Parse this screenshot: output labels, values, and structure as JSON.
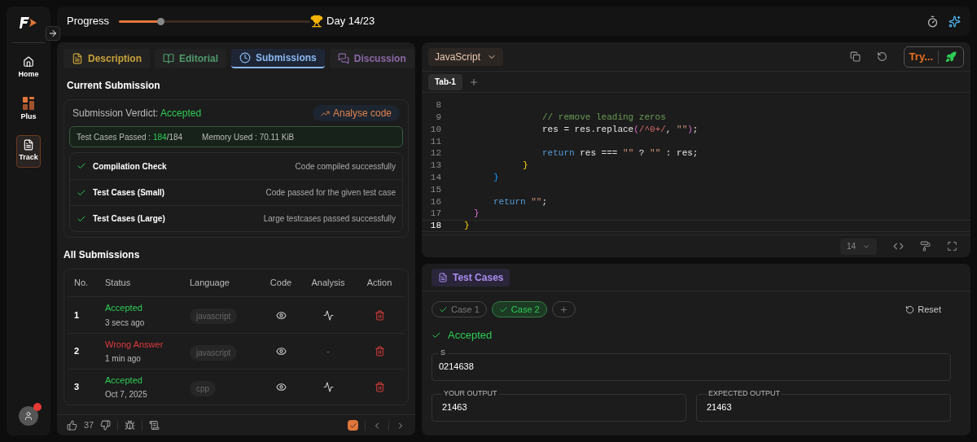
{
  "sidebar": {
    "items": [
      {
        "label": "Home",
        "kind": "home",
        "selected": false
      },
      {
        "label": "Plus",
        "kind": "plus",
        "selected": false
      },
      {
        "label": "Track",
        "kind": "track",
        "selected": true
      }
    ],
    "notification": true
  },
  "progress": {
    "label": "Progress",
    "level": 0.22,
    "day": "Day 14/23"
  },
  "left_tabs": [
    {
      "label": "Description",
      "kind": "description",
      "color": "#c9a23a",
      "selected": false
    },
    {
      "label": "Editorial",
      "kind": "editorial",
      "color": "#4f9a6c",
      "selected": false
    },
    {
      "label": "Submissions",
      "kind": "submissions",
      "color": "#8ab8ef",
      "selected": true
    },
    {
      "label": "Discussion",
      "kind": "discussion",
      "color": "#8a6aa8",
      "selected": false
    }
  ],
  "current_submission": {
    "title": "Current Submission",
    "verdict_label": "Submission Verdict:",
    "verdict": "Accepted",
    "analyse_button": "Analyse code",
    "passed_label": "Test Cases Passed :",
    "passed": "184",
    "total": "/184",
    "memory": "Memory Used : 70.11 KiB",
    "checks": [
      {
        "label": "Compilation Check",
        "detail": "Code compiled successfully"
      },
      {
        "label": "Test Cases (Small)",
        "detail": "Code passed for the given test case"
      },
      {
        "label": "Test Cases (Large)",
        "detail": "Large testcases passed successfully"
      }
    ]
  },
  "all_submissions": {
    "title": "All Submissions",
    "columns": [
      "No.",
      "Status",
      "Language",
      "Code",
      "Analysis",
      "Action"
    ],
    "rows": [
      {
        "no": "1",
        "status": "Accepted",
        "kind": "accepted",
        "time": "3 secs ago",
        "language": "javascript"
      },
      {
        "no": "2",
        "status": "Wrong Answer",
        "kind": "wrong",
        "time": "1 min ago",
        "language": "javascript",
        "analysis": "-"
      },
      {
        "no": "3",
        "status": "Accepted",
        "kind": "accepted",
        "time": "Oct 7, 2025",
        "language": "cpp"
      }
    ]
  },
  "footer": {
    "likes": "37",
    "checked": true
  },
  "editor": {
    "language": "JavaScript",
    "try_button": "Try...",
    "tabs": [
      {
        "label": "Tab-1",
        "selected": true
      }
    ],
    "font_size": "14",
    "lines": [
      {
        "number": "8",
        "selected": false
      },
      {
        "number": "9",
        "selected": false,
        "kind": "depth3",
        "tokens": [
          {
            "kind": "comment",
            "text": "// remove leading zeros"
          }
        ]
      },
      {
        "number": "10",
        "selected": false,
        "kind": "depth3",
        "tokens": [
          {
            "kind": "plain",
            "text": "res = res.replace"
          },
          {
            "kind": "paren",
            "text": "("
          },
          {
            "kind": "regex",
            "text": "/^0+/"
          },
          {
            "kind": "plain",
            "text": ", "
          },
          {
            "kind": "string",
            "text": "\"\""
          },
          {
            "kind": "paren",
            "text": ")"
          },
          {
            "kind": "plain",
            "text": ";"
          }
        ]
      },
      {
        "number": "11",
        "selected": false
      },
      {
        "number": "12",
        "selected": false,
        "kind": "depth3",
        "tokens": [
          {
            "kind": "keyword",
            "text": "return"
          },
          {
            "kind": "plain",
            "text": " res === "
          },
          {
            "kind": "string",
            "text": "\"\""
          },
          {
            "kind": "plain",
            "text": " ? "
          },
          {
            "kind": "string",
            "text": "\"\""
          },
          {
            "kind": "plain",
            "text": " : res;"
          }
        ]
      },
      {
        "number": "13",
        "selected": false,
        "kind": "depth2",
        "tokens": [
          {
            "kind": "brace1",
            "text": "}"
          }
        ]
      },
      {
        "number": "14",
        "selected": false,
        "kind": "depth1",
        "tokens": [
          {
            "kind": "brace3",
            "text": "}"
          }
        ]
      },
      {
        "number": "15",
        "selected": false
      },
      {
        "number": "16",
        "selected": false,
        "kind": "depth1",
        "tokens": [
          {
            "kind": "keyword",
            "text": "return"
          },
          {
            "kind": "string",
            "text": " \"\""
          },
          {
            "kind": "plain",
            "text": ";"
          }
        ]
      },
      {
        "number": "17",
        "selected": false,
        "kind": "depth0",
        "tokens": [
          {
            "kind": "brace2",
            "text": "}"
          }
        ]
      },
      {
        "number": "18",
        "selected": true,
        "tokens": [
          {
            "kind": "brace1",
            "text": "}"
          }
        ]
      }
    ]
  },
  "test_panel": {
    "title": "Test Cases",
    "cases": [
      {
        "label": "Case 1",
        "passed": true,
        "selected": false
      },
      {
        "label": "Case 2",
        "passed": true,
        "selected": true
      }
    ],
    "reset": "Reset",
    "result": "Accepted",
    "input": {
      "label": "S",
      "value": "0214638"
    },
    "outputs": [
      {
        "label": "YOUR OUTPUT",
        "value": "21463"
      },
      {
        "label": "EXPECTED OUTPUT",
        "value": "21463"
      }
    ]
  }
}
